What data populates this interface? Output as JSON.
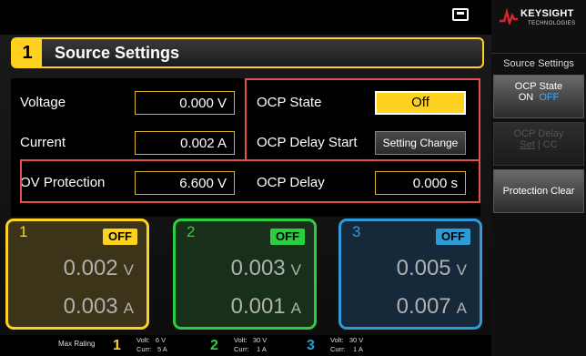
{
  "title_bar": {
    "channel_number": "1",
    "title": "Source Settings"
  },
  "settings": {
    "voltage_label": "Voltage",
    "voltage_value": "0.000 V",
    "current_label": "Current",
    "current_value": "0.002 A",
    "ov_protection_label": "OV Protection",
    "ov_protection_value": "6.600 V",
    "ocp_state_label": "OCP State",
    "ocp_state_value": "Off",
    "ocp_delay_start_label": "OCP Delay Start",
    "ocp_delay_start_value": "Setting Change",
    "ocp_delay_label": "OCP Delay",
    "ocp_delay_value": "0.000 s"
  },
  "channels": [
    {
      "number": "1",
      "state": "OFF",
      "voltage": "0.002",
      "volt_unit": "V",
      "current": "0.003",
      "curr_unit": "A",
      "color": "#ffd21f",
      "bg": "#3c3418"
    },
    {
      "number": "2",
      "state": "OFF",
      "voltage": "0.003",
      "volt_unit": "V",
      "current": "0.001",
      "curr_unit": "A",
      "color": "#2ecc40",
      "bg": "#18301a"
    },
    {
      "number": "3",
      "state": "OFF",
      "voltage": "0.005",
      "volt_unit": "V",
      "current": "0.007",
      "curr_unit": "A",
      "color": "#2e9bd6",
      "bg": "#15293a"
    }
  ],
  "status_bar": {
    "label": "Max Rating",
    "ratings": [
      {
        "channel": "1",
        "volt_label": "Volt:",
        "volt_value": "6",
        "volt_unit": "V",
        "curr_label": "Curr:",
        "curr_value": "5",
        "curr_unit": "A"
      },
      {
        "channel": "2",
        "volt_label": "Volt:",
        "volt_value": "30",
        "volt_unit": "V",
        "curr_label": "Curr:",
        "curr_value": "1",
        "curr_unit": "A"
      },
      {
        "channel": "3",
        "volt_label": "Volt:",
        "volt_value": "30",
        "volt_unit": "V",
        "curr_label": "Curr:",
        "curr_value": "1",
        "curr_unit": "A"
      }
    ]
  },
  "sidebar": {
    "brand": "KEYSIGHT",
    "brand_sub": "TECHNOLOGIES",
    "menu_title": "Source Settings",
    "ocp_state_key": {
      "label": "OCP State",
      "on": "ON",
      "off": "OFF"
    },
    "ocp_delay_key": {
      "label": "OCP Delay",
      "set": "Set",
      "sep": "|",
      "cc": "CC"
    },
    "protection_clear_key": {
      "label": "Protection Clear"
    }
  },
  "colors": {
    "accent": "#ffd21f",
    "highlight_red": "#e05050",
    "ch1": "#ffd21f",
    "ch2": "#2ecc40",
    "ch3": "#2e9bd6",
    "brand_red": "#e0202a",
    "off_blue": "#3fa8ff"
  },
  "icons": {
    "usb": "usb-drive-icon",
    "logo": "keysight-wave-logo-icon"
  }
}
